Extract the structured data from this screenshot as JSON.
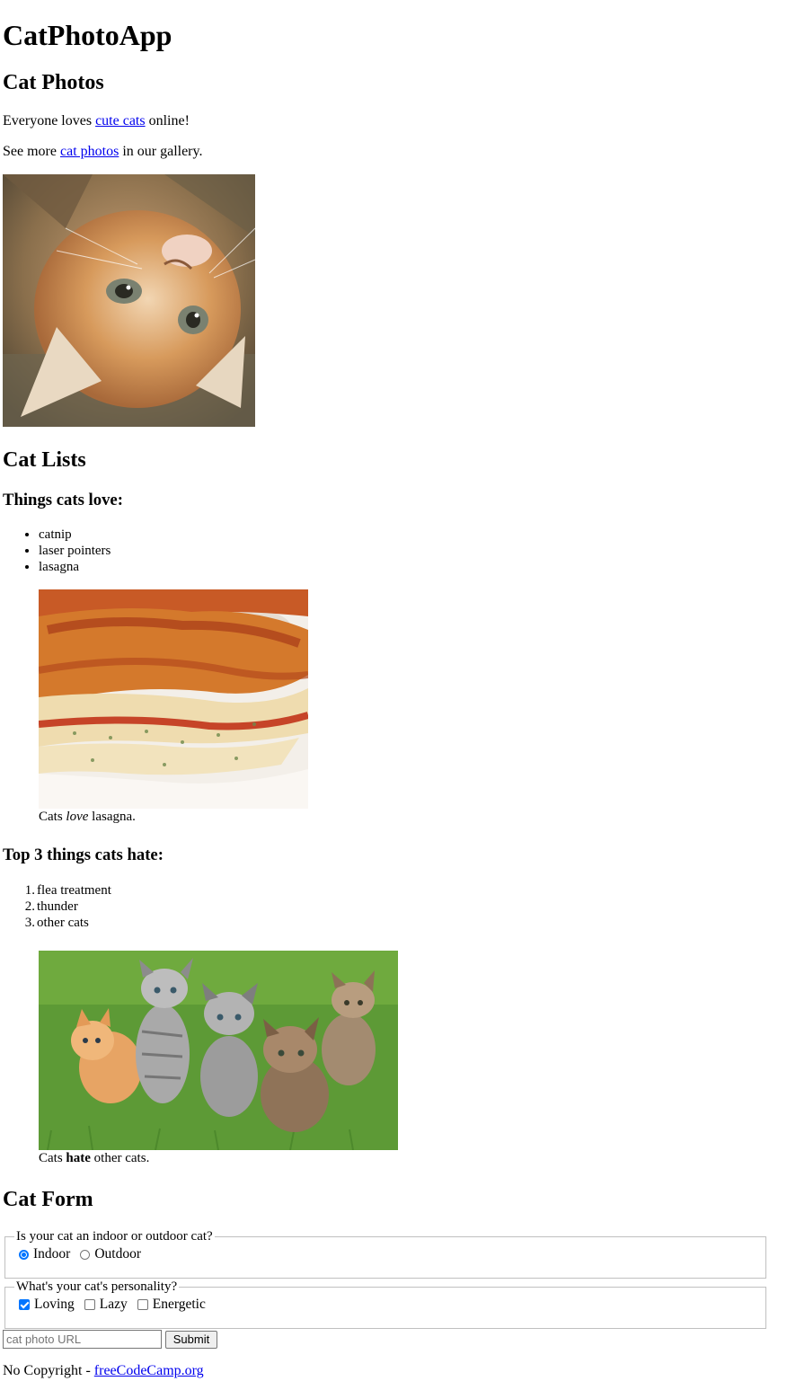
{
  "app": {
    "title": "CatPhotoApp"
  },
  "photos_section": {
    "heading": "Cat Photos",
    "intro": {
      "before": "Everyone loves ",
      "link": "cute cats",
      "after": " online!"
    },
    "more": {
      "before": "See more ",
      "link": "cat photos",
      "after": " in our gallery."
    },
    "kitten_image": {
      "description": "kitten lying on its back",
      "icon": "kitten-photo"
    }
  },
  "lists_section": {
    "heading": "Cat Lists",
    "love_heading": "Things cats love:",
    "love_items": [
      "catnip",
      "laser pointers",
      "lasagna"
    ],
    "lasagna_caption": {
      "before": "Cats ",
      "emphasis": "love",
      "after": " lasagna."
    },
    "hate_heading": "Top 3 things cats hate:",
    "hate_items": [
      "flea treatment",
      "thunder",
      "other cats"
    ],
    "hate_numbers": [
      "1.",
      "2.",
      "3."
    ],
    "cats_caption": {
      "before": "Cats ",
      "strong": "hate",
      "after": " other cats."
    }
  },
  "form_section": {
    "heading": "Cat Form",
    "location_legend": "Is your cat an indoor or outdoor cat?",
    "location_options": [
      {
        "label": "Indoor",
        "selected": true
      },
      {
        "label": "Outdoor",
        "selected": false
      }
    ],
    "personality_legend": "What's your cat's personality?",
    "personality_options": [
      {
        "label": "Loving",
        "checked": true
      },
      {
        "label": "Lazy",
        "checked": false
      },
      {
        "label": "Energetic",
        "checked": false
      }
    ],
    "url_placeholder": "cat photo URL",
    "submit_label": "Submit"
  },
  "footer": {
    "text": "No Copyright - ",
    "link": "freeCodeCamp.org"
  },
  "colors": {
    "link": "#0000ee",
    "accent": "#0075ff",
    "fieldset_border": "#c0c0c0"
  }
}
